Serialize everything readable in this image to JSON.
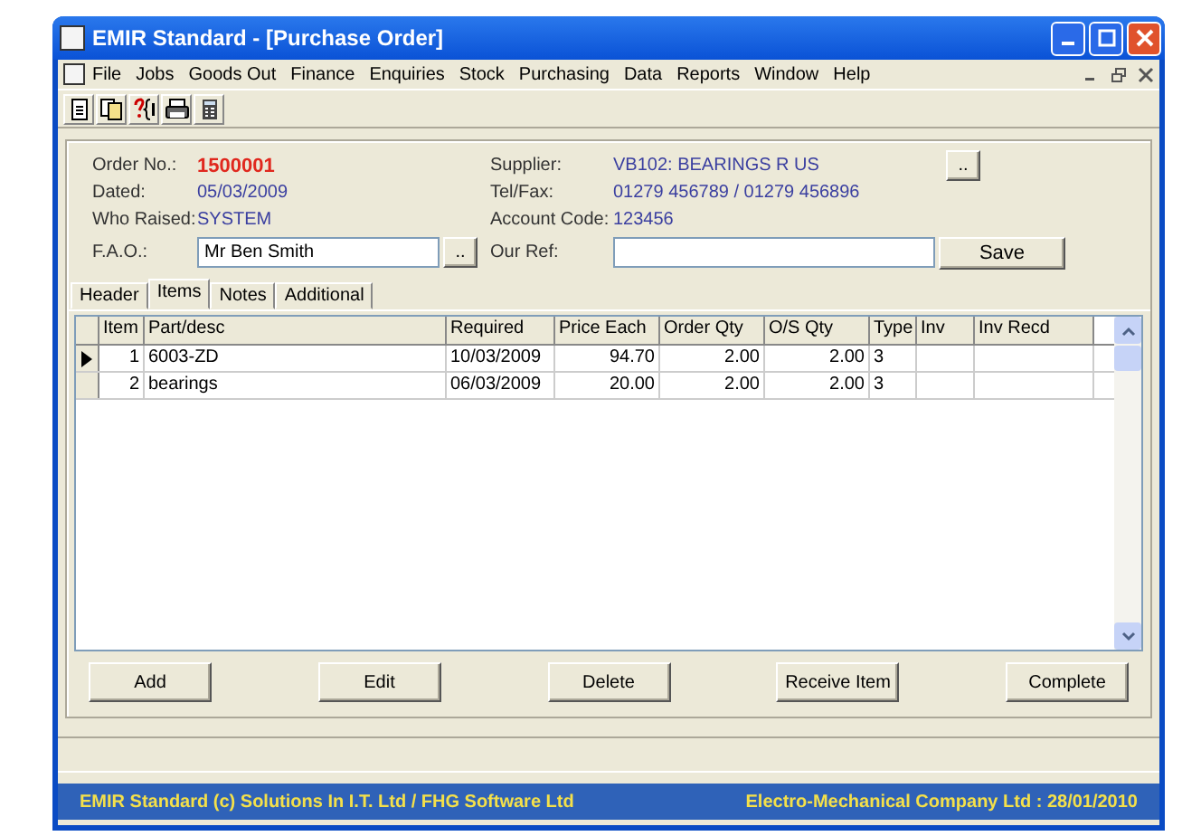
{
  "window": {
    "title": "EMIR Standard - [Purchase Order]"
  },
  "menu": [
    "File",
    "Jobs",
    "Goods Out",
    "Finance",
    "Enquiries",
    "Stock",
    "Purchasing",
    "Data",
    "Reports",
    "Window",
    "Help"
  ],
  "header": {
    "order_no_label": "Order No.:",
    "order_no": "1500001",
    "dated_label": "Dated:",
    "dated": "05/03/2009",
    "raised_label": "Who Raised:",
    "raised": "SYSTEM",
    "fao_label": "F.A.O.:",
    "fao": "Mr Ben Smith",
    "supplier_label": "Supplier:",
    "supplier": "VB102: BEARINGS R US",
    "telfax_label": "Tel/Fax:",
    "telfax": "01279 456789 / 01279 456896",
    "account_label": "Account Code:",
    "account": "123456",
    "ref_label": "Our Ref:",
    "lookup_button": "..",
    "save_button": "Save"
  },
  "tabs": [
    {
      "label": "Header",
      "selected": false
    },
    {
      "label": "Items",
      "selected": true
    },
    {
      "label": "Notes",
      "selected": false
    },
    {
      "label": "Additional",
      "selected": false
    }
  ],
  "table": {
    "columns": [
      "Item",
      "Part/desc",
      "Required",
      "Price Each",
      "Order Qty",
      "O/S Qty",
      "Type",
      "Inv",
      "Inv Recd"
    ],
    "rows": [
      {
        "cells": [
          "1",
          "6003-ZD",
          "10/03/2009",
          "94.70",
          "2.00",
          "2.00",
          "3",
          "",
          ""
        ],
        "selected": true
      },
      {
        "cells": [
          "2",
          "bearings",
          "06/03/2009",
          "20.00",
          "2.00",
          "2.00",
          "3",
          "",
          ""
        ],
        "selected": false
      }
    ]
  },
  "buttons": [
    "Add",
    "Edit",
    "Delete",
    "Receive Item",
    "Complete"
  ],
  "status_bar": {
    "left": "EMIR Standard (c) Solutions In I.T. Ltd / FHG Software Ltd",
    "right": "Electro-Mechanical Company Ltd : 28/01/2010"
  }
}
